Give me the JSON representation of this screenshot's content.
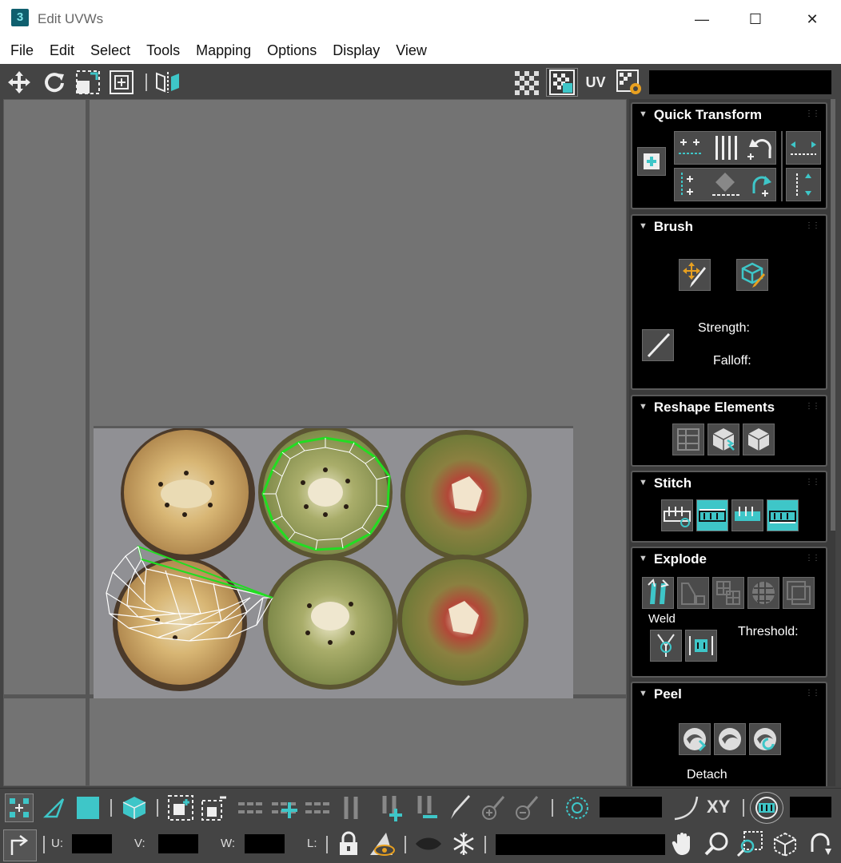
{
  "window": {
    "app_icon_text": "3",
    "title": "Edit UVWs"
  },
  "menu": [
    "File",
    "Edit",
    "Select",
    "Tools",
    "Mapping",
    "Options",
    "Display",
    "View"
  ],
  "toolbar": {
    "uv_label": "UV"
  },
  "panel": {
    "quick_transform": {
      "title": "Quick Transform"
    },
    "brush": {
      "title": "Brush",
      "strength_label": "Strength:",
      "falloff_label": "Falloff:"
    },
    "reshape": {
      "title": "Reshape Elements"
    },
    "stitch": {
      "title": "Stitch"
    },
    "explode": {
      "title": "Explode",
      "weld_label": "Weld",
      "threshold_label": "Threshold:"
    },
    "peel": {
      "title": "Peel",
      "detach_label": "Detach"
    }
  },
  "bottom": {
    "xy_label": "XY",
    "u_label": "U:",
    "v_label": "V:",
    "w_label": "W:",
    "l_label": "L:"
  },
  "colors": {
    "accent": "#3ec6c8",
    "selection": "#22dd22",
    "panel_bg": "#000000",
    "toolbar_bg": "#444444",
    "viewport_bg": "#737373"
  }
}
